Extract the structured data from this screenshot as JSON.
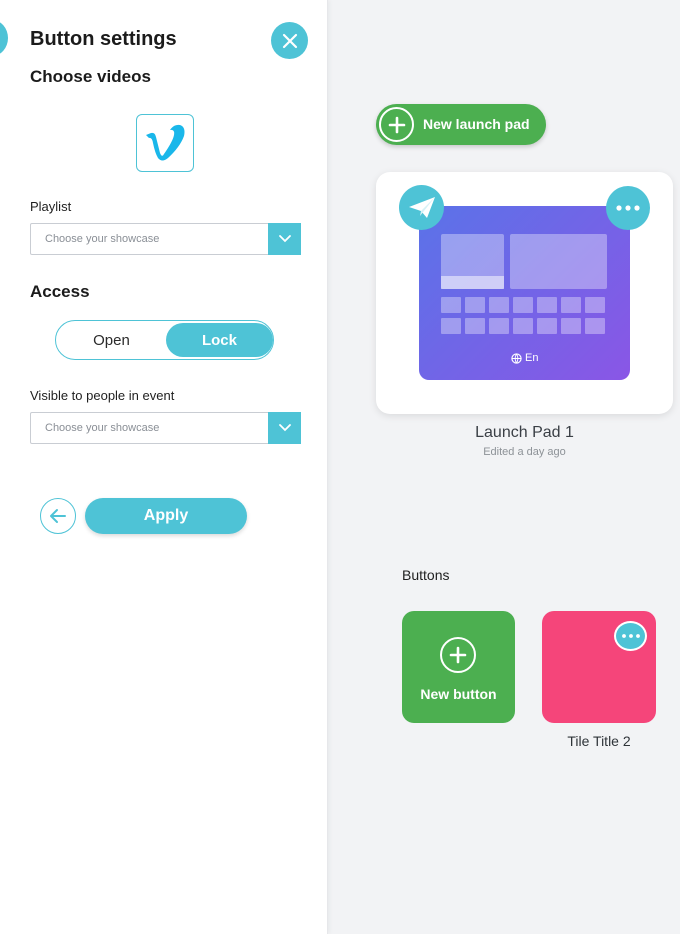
{
  "panel": {
    "title": "Button settings",
    "close_icon": "close-icon",
    "choose_videos_heading": "Choose videos",
    "video_source_icon": "vimeo-logo",
    "playlist": {
      "label": "Playlist",
      "placeholder": "Choose your showcase",
      "arrow_icon": "chevron-down-icon"
    },
    "access": {
      "heading": "Access",
      "options": [
        "Open",
        "Lock"
      ],
      "selected": "Lock"
    },
    "visible_to": {
      "label": "Visible to people in event",
      "placeholder": "Choose your showcase",
      "arrow_icon": "chevron-down-icon"
    },
    "back_icon": "arrow-left-icon",
    "apply_label": "Apply"
  },
  "main": {
    "new_launch_pad_label": "New launch pad",
    "launch_pad": {
      "name": "Launch Pad 1",
      "edited": "Edited a day ago",
      "language": "En",
      "send_icon": "paper-plane-icon",
      "more_icon": "more-dots-icon"
    },
    "buttons_heading": "Buttons",
    "new_button_label": "New button",
    "tiles": [
      {
        "title": "Tile Title 2",
        "color": "#f5457a"
      }
    ]
  },
  "colors": {
    "accent": "#4ec3d6",
    "green": "#4caf50",
    "pink": "#f5457a",
    "launch_pad_gradient_start": "#5a73e8",
    "launch_pad_gradient_end": "#8a56e6"
  }
}
